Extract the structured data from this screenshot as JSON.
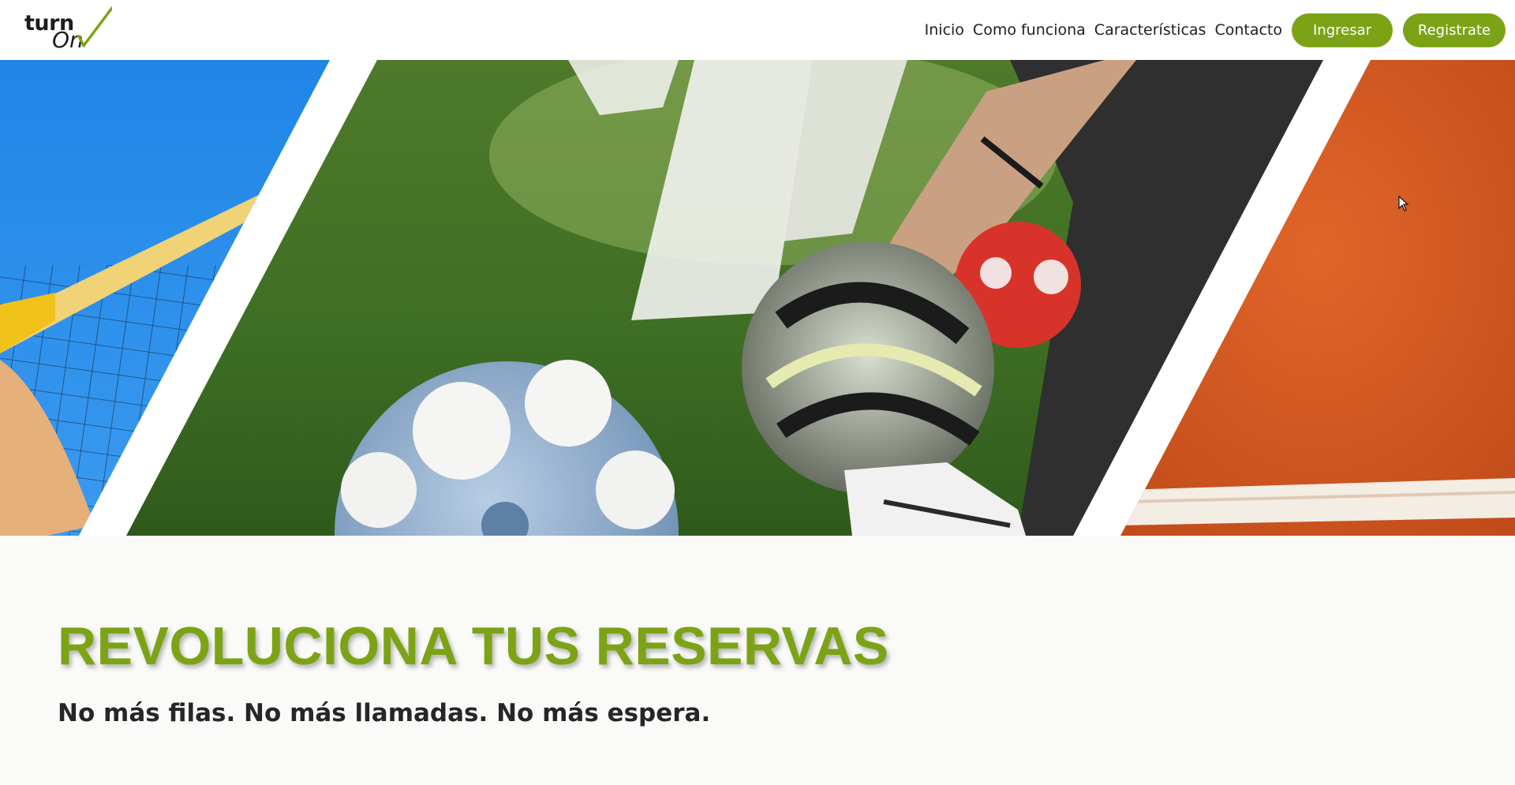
{
  "header": {
    "logo": {
      "word_top": "turn",
      "word_bottom": "On",
      "check_color": "#7ca316"
    },
    "nav": {
      "items": [
        {
          "label": "Inicio"
        },
        {
          "label": "Como funciona"
        },
        {
          "label": "Características"
        },
        {
          "label": "Contacto"
        }
      ],
      "login_label": "Ingresar",
      "signup_label": "Registrate"
    }
  },
  "hero": {
    "panels": [
      "beach-volleyball-net",
      "soccer-balls-on-grass",
      "clay-tennis-court"
    ]
  },
  "main": {
    "headline": "REVOLUCIONA TUS RESERVAS",
    "tagline": "No más filas. No más llamadas. No más espera."
  },
  "colors": {
    "accent": "#7ca316",
    "text_dark": "#262626",
    "page_background": "#fafaf8"
  }
}
